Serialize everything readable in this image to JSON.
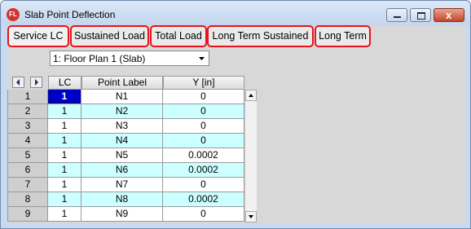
{
  "window": {
    "title": "Slab Point Deflection",
    "app_icon_text": "FL",
    "close_glyph": "x"
  },
  "tabs": [
    {
      "label": "Service LC",
      "active": true
    },
    {
      "label": "Sustained Load",
      "active": false
    },
    {
      "label": "Total Load",
      "active": false
    },
    {
      "label": "Long Term Sustained",
      "active": false
    },
    {
      "label": "Long Term",
      "active": false
    }
  ],
  "plan_select": {
    "value": "1: Floor Plan 1 (Slab)"
  },
  "grid": {
    "columns": [
      "LC",
      "Point Label",
      "Y [in]"
    ],
    "rows": [
      {
        "num": "1",
        "lc": "1",
        "label": "N1",
        "y": "0"
      },
      {
        "num": "2",
        "lc": "1",
        "label": "N2",
        "y": "0"
      },
      {
        "num": "3",
        "lc": "1",
        "label": "N3",
        "y": "0"
      },
      {
        "num": "4",
        "lc": "1",
        "label": "N4",
        "y": "0"
      },
      {
        "num": "5",
        "lc": "1",
        "label": "N5",
        "y": "0.0002"
      },
      {
        "num": "6",
        "lc": "1",
        "label": "N6",
        "y": "0.0002"
      },
      {
        "num": "7",
        "lc": "1",
        "label": "N7",
        "y": "0"
      },
      {
        "num": "8",
        "lc": "1",
        "label": "N8",
        "y": "0.0002"
      },
      {
        "num": "9",
        "lc": "1",
        "label": "N9",
        "y": "0"
      }
    ]
  },
  "colors": {
    "highlight_box": "#e8131b",
    "row_alt": "#ccffff",
    "selected_cell": "#0000cc"
  }
}
